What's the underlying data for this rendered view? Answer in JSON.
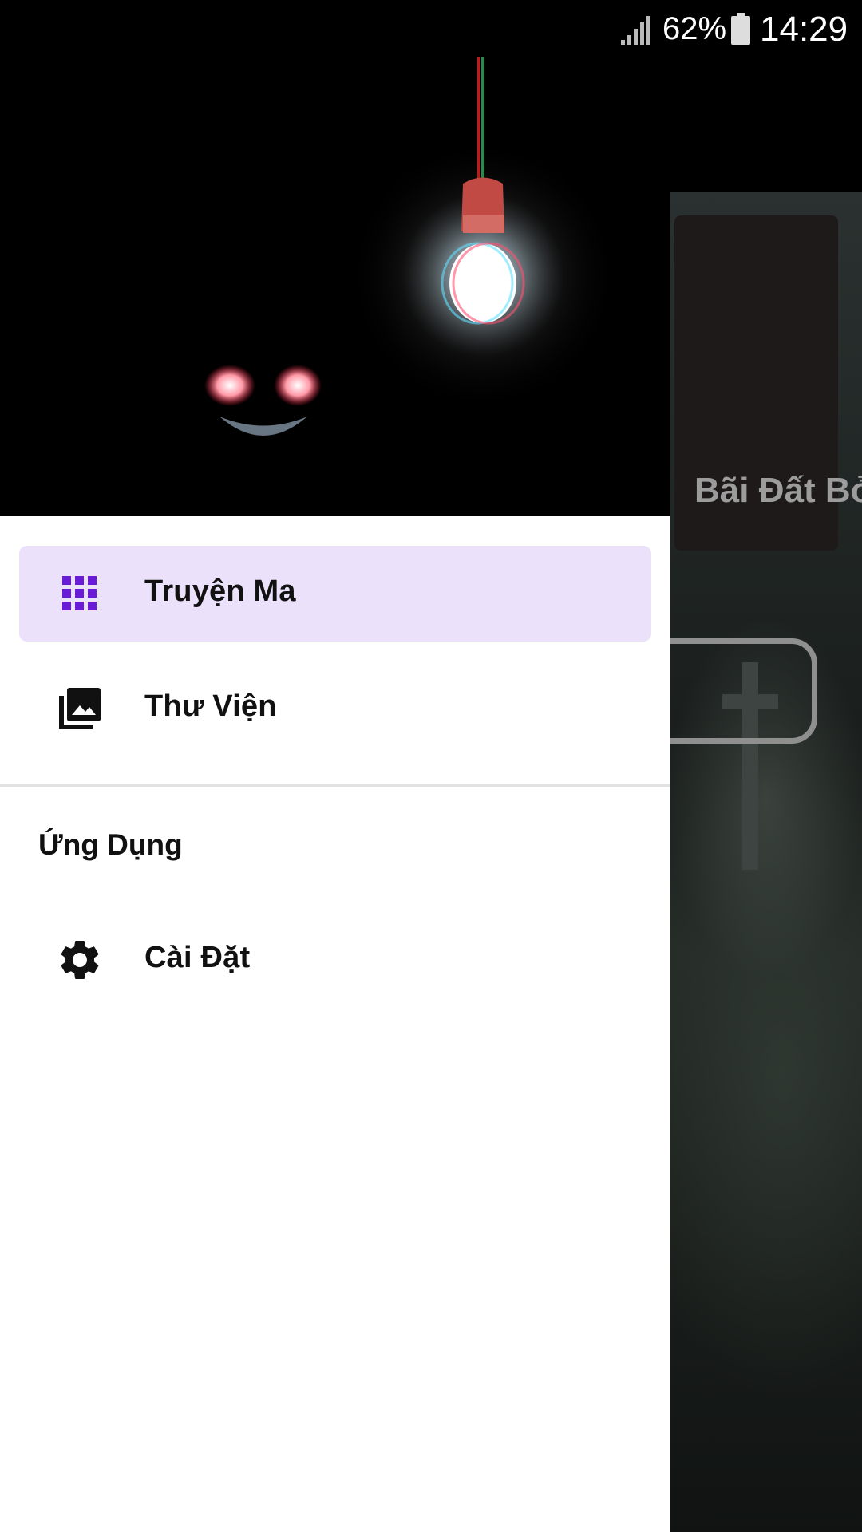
{
  "status_bar": {
    "battery_percent": "62%",
    "time": "14:29",
    "signal_icon": "signal-icon",
    "battery_icon": "battery-icon"
  },
  "background_app": {
    "card_title": "Bãi Đất Bỏ"
  },
  "drawer": {
    "items": [
      {
        "label": "Truyện Ma",
        "icon": "grid-icon",
        "active": true
      },
      {
        "label": "Thư Viện",
        "icon": "photo-library-icon",
        "active": false
      }
    ],
    "section_header": "Ứng Dụng",
    "section_items": [
      {
        "label": "Cài Đặt",
        "icon": "gear-icon",
        "active": false
      }
    ]
  },
  "colors": {
    "active_background": "#ece1fb",
    "accent": "#6a1bd6"
  }
}
